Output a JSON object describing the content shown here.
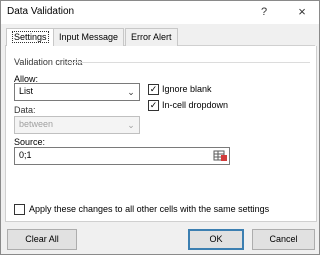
{
  "window": {
    "title": "Data Validation",
    "help_glyph": "?",
    "close_glyph": "×"
  },
  "tabs": [
    {
      "label": "Settings",
      "active": true
    },
    {
      "label": "Input Message",
      "active": false
    },
    {
      "label": "Error Alert",
      "active": false
    }
  ],
  "settings": {
    "group_label": "Validation criteria",
    "allow_label": "Allow:",
    "allow_value": "List",
    "ignore_blank_label": "Ignore blank",
    "ignore_blank_checked": true,
    "incell_dropdown_label": "In-cell dropdown",
    "incell_dropdown_checked": true,
    "data_label": "Data:",
    "data_value": "between",
    "source_label": "Source:",
    "source_value": "0;1",
    "apply_all_label": "Apply these changes to all other cells with the same settings",
    "apply_all_checked": false
  },
  "buttons": {
    "clear_all": "Clear All",
    "ok": "OK",
    "cancel": "Cancel"
  },
  "icons": {
    "combo_arrow": "chevron-down-icon",
    "range_selector": "range-selector-icon"
  }
}
